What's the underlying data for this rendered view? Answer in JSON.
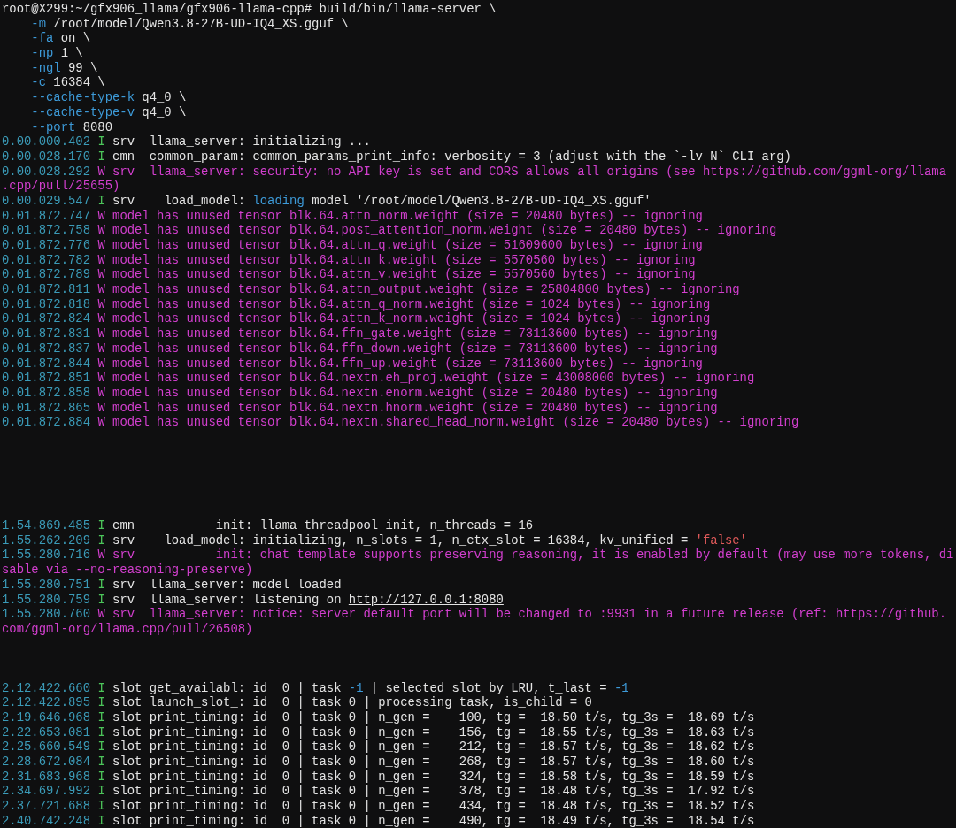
{
  "terminal": {
    "lines": [
      {
        "kind": "text",
        "segments": [
          {
            "kind": "plain",
            "text": "root@X299:~/gfx906_llama/gfx906-llama-cpp# build/bin/llama-server \\"
          }
        ]
      },
      {
        "kind": "option",
        "segments": [
          {
            "kind": "flag",
            "text": "-m"
          },
          {
            "kind": "plain",
            "text": " /root/model/Qwen3.8-27B-UD-IQ4_XS.gguf \\"
          }
        ]
      },
      {
        "kind": "option",
        "segments": [
          {
            "kind": "flag",
            "text": "-fa"
          },
          {
            "kind": "plain",
            "text": " on \\"
          }
        ]
      },
      {
        "kind": "option",
        "segments": [
          {
            "kind": "flag",
            "text": "-np"
          },
          {
            "kind": "plain",
            "text": " 1 \\"
          }
        ]
      },
      {
        "kind": "option",
        "segments": [
          {
            "kind": "flag",
            "text": "-ngl"
          },
          {
            "kind": "plain",
            "text": " 99 \\"
          }
        ]
      },
      {
        "kind": "option",
        "segments": [
          {
            "kind": "flag",
            "text": "-c"
          },
          {
            "kind": "plain",
            "text": " 16384 \\"
          }
        ]
      },
      {
        "kind": "option",
        "segments": [
          {
            "kind": "flag",
            "text": "--cache-type-k"
          },
          {
            "kind": "plain",
            "text": " q4_0 \\"
          }
        ]
      },
      {
        "kind": "option",
        "segments": [
          {
            "kind": "flag",
            "text": "--cache-type-v"
          },
          {
            "kind": "plain",
            "text": " q4_0 \\"
          }
        ]
      },
      {
        "kind": "option",
        "segments": [
          {
            "kind": "flag",
            "text": "--port"
          },
          {
            "kind": "plain",
            "text": " 8080"
          }
        ]
      },
      {
        "kind": "text",
        "segments": [
          {
            "kind": "time",
            "text": "0.00.000.402 "
          },
          {
            "kind": "info",
            "text": "I"
          },
          {
            "kind": "plain",
            "text": " srv  llama_server: initializing ..."
          }
        ]
      },
      {
        "kind": "text",
        "segments": [
          {
            "kind": "time",
            "text": "0.00.028.170 "
          },
          {
            "kind": "info",
            "text": "I"
          },
          {
            "kind": "plain",
            "text": " cmn  common_param: common_params_print_info: verbosity = 3 (adjust with the `-lv N` CLI arg)"
          }
        ]
      },
      {
        "kind": "text",
        "segments": [
          {
            "kind": "time",
            "text": "0.00.028.292 "
          },
          {
            "kind": "warn",
            "text": "W srv  llama_server: security: no API key is set and CORS allows all origins (see https://github.com/ggml-org/llama"
          }
        ]
      },
      {
        "kind": "text",
        "segments": [
          {
            "kind": "warn",
            "text": ".cpp/pull/25655)"
          }
        ]
      },
      {
        "kind": "text",
        "segments": [
          {
            "kind": "time",
            "text": "0.00.029.547 "
          },
          {
            "kind": "info",
            "text": "I"
          },
          {
            "kind": "plain",
            "text": " srv    load_model: "
          },
          {
            "kind": "keyword",
            "text": "loading"
          },
          {
            "kind": "plain",
            "text": " model '/root/model/Qwen3.8-27B-UD-IQ4_XS.gguf'"
          }
        ]
      },
      {
        "kind": "text",
        "segments": [
          {
            "kind": "time",
            "text": "0.01.872.747 "
          },
          {
            "kind": "warn",
            "text": "W model has unused tensor blk.64.attn_norm.weight (size = 20480 bytes) -- ignoring"
          }
        ]
      },
      {
        "kind": "text",
        "segments": [
          {
            "kind": "time",
            "text": "0.01.872.758 "
          },
          {
            "kind": "warn",
            "text": "W model has unused tensor blk.64.post_attention_norm.weight (size = 20480 bytes) -- ignoring"
          }
        ]
      },
      {
        "kind": "text",
        "segments": [
          {
            "kind": "time",
            "text": "0.01.872.776 "
          },
          {
            "kind": "warn",
            "text": "W model has unused tensor blk.64.attn_q.weight (size = 51609600 bytes) -- ignoring"
          }
        ]
      },
      {
        "kind": "text",
        "segments": [
          {
            "kind": "time",
            "text": "0.01.872.782 "
          },
          {
            "kind": "warn",
            "text": "W model has unused tensor blk.64.attn_k.weight (size = 5570560 bytes) -- ignoring"
          }
        ]
      },
      {
        "kind": "text",
        "segments": [
          {
            "kind": "time",
            "text": "0.01.872.789 "
          },
          {
            "kind": "warn",
            "text": "W model has unused tensor blk.64.attn_v.weight (size = 5570560 bytes) -- ignoring"
          }
        ]
      },
      {
        "kind": "text",
        "segments": [
          {
            "kind": "time",
            "text": "0.01.872.811 "
          },
          {
            "kind": "warn",
            "text": "W model has unused tensor blk.64.attn_output.weight (size = 25804800 bytes) -- ignoring"
          }
        ]
      },
      {
        "kind": "text",
        "segments": [
          {
            "kind": "time",
            "text": "0.01.872.818 "
          },
          {
            "kind": "warn",
            "text": "W model has unused tensor blk.64.attn_q_norm.weight (size = 1024 bytes) -- ignoring"
          }
        ]
      },
      {
        "kind": "text",
        "segments": [
          {
            "kind": "time",
            "text": "0.01.872.824 "
          },
          {
            "kind": "warn",
            "text": "W model has unused tensor blk.64.attn_k_norm.weight (size = 1024 bytes) -- ignoring"
          }
        ]
      },
      {
        "kind": "text",
        "segments": [
          {
            "kind": "time",
            "text": "0.01.872.831 "
          },
          {
            "kind": "warn",
            "text": "W model has unused tensor blk.64.ffn_gate.weight (size = 73113600 bytes) -- ignoring"
          }
        ]
      },
      {
        "kind": "text",
        "segments": [
          {
            "kind": "time",
            "text": "0.01.872.837 "
          },
          {
            "kind": "warn",
            "text": "W model has unused tensor blk.64.ffn_down.weight (size = 73113600 bytes) -- ignoring"
          }
        ]
      },
      {
        "kind": "text",
        "segments": [
          {
            "kind": "time",
            "text": "0.01.872.844 "
          },
          {
            "kind": "warn",
            "text": "W model has unused tensor blk.64.ffn_up.weight (size = 73113600 bytes) -- ignoring"
          }
        ]
      },
      {
        "kind": "text",
        "segments": [
          {
            "kind": "time",
            "text": "0.01.872.851 "
          },
          {
            "kind": "warn",
            "text": "W model has unused tensor blk.64.nextn.eh_proj.weight (size = 43008000 bytes) -- ignoring"
          }
        ]
      },
      {
        "kind": "text",
        "segments": [
          {
            "kind": "time",
            "text": "0.01.872.858 "
          },
          {
            "kind": "warn",
            "text": "W model has unused tensor blk.64.nextn.enorm.weight (size = 20480 bytes) -- ignoring"
          }
        ]
      },
      {
        "kind": "text",
        "segments": [
          {
            "kind": "time",
            "text": "0.01.872.865 "
          },
          {
            "kind": "warn",
            "text": "W model has unused tensor blk.64.nextn.hnorm.weight (size = 20480 bytes) -- ignoring"
          }
        ]
      },
      {
        "kind": "text",
        "segments": [
          {
            "kind": "time",
            "text": "0.01.872.884 "
          },
          {
            "kind": "warn",
            "text": "W model has unused tensor blk.64.nextn.shared_head_norm.weight (size = 20480 bytes) -- ignoring"
          }
        ]
      },
      {
        "kind": "blank"
      },
      {
        "kind": "blank"
      },
      {
        "kind": "blank"
      },
      {
        "kind": "blank"
      },
      {
        "kind": "blank"
      },
      {
        "kind": "blank"
      },
      {
        "kind": "text",
        "segments": [
          {
            "kind": "time",
            "text": "1.54.869.485 "
          },
          {
            "kind": "info",
            "text": "I"
          },
          {
            "kind": "plain",
            "text": " cmn           init: llama threadpool init, n_threads = 16"
          }
        ]
      },
      {
        "kind": "text",
        "segments": [
          {
            "kind": "time",
            "text": "1.55.262.209 "
          },
          {
            "kind": "info",
            "text": "I"
          },
          {
            "kind": "plain",
            "text": " srv    load_model: initializing, n_slots = 1, n_ctx_slot = 16384, kv_unified = "
          },
          {
            "kind": "string",
            "text": "'false'"
          }
        ]
      },
      {
        "kind": "text",
        "segments": [
          {
            "kind": "time",
            "text": "1.55.280.716 "
          },
          {
            "kind": "warn",
            "text": "W srv           init: chat template supports preserving reasoning, it is enabled by default (may use more tokens, di"
          }
        ]
      },
      {
        "kind": "text",
        "segments": [
          {
            "kind": "warn",
            "text": "sable via --no-reasoning-preserve)"
          }
        ]
      },
      {
        "kind": "text",
        "segments": [
          {
            "kind": "time",
            "text": "1.55.280.751 "
          },
          {
            "kind": "info",
            "text": "I"
          },
          {
            "kind": "plain",
            "text": " srv  llama_server: model loaded"
          }
        ]
      },
      {
        "kind": "text",
        "segments": [
          {
            "kind": "time",
            "text": "1.55.280.759 "
          },
          {
            "kind": "info",
            "text": "I"
          },
          {
            "kind": "plain",
            "text": " srv  llama_server: listening on "
          },
          {
            "kind": "link",
            "text": "http://127.0.0.1:8080"
          }
        ]
      },
      {
        "kind": "text",
        "segments": [
          {
            "kind": "time",
            "text": "1.55.280.760 "
          },
          {
            "kind": "warn",
            "text": "W srv  llama_server: notice: server default port will be changed to :9931 in a future release (ref: https://github."
          }
        ]
      },
      {
        "kind": "text",
        "segments": [
          {
            "kind": "warn",
            "text": "com/ggml-org/llama.cpp/pull/26508)"
          }
        ]
      },
      {
        "kind": "blank"
      },
      {
        "kind": "blank"
      },
      {
        "kind": "blank"
      },
      {
        "kind": "text",
        "segments": [
          {
            "kind": "time",
            "text": "2.12.422.660 "
          },
          {
            "kind": "info",
            "text": "I"
          },
          {
            "kind": "plain",
            "text": " slot get_availabl: id  0 | task "
          },
          {
            "kind": "number",
            "text": "-1"
          },
          {
            "kind": "plain",
            "text": " | selected slot by LRU, t_last = "
          },
          {
            "kind": "number",
            "text": "-1"
          }
        ]
      },
      {
        "kind": "text",
        "segments": [
          {
            "kind": "time",
            "text": "2.12.422.895 "
          },
          {
            "kind": "info",
            "text": "I"
          },
          {
            "kind": "plain",
            "text": " slot launch_slot_: id  0 | task 0 | processing task, is_child = 0"
          }
        ]
      },
      {
        "kind": "text",
        "segments": [
          {
            "kind": "time",
            "text": "2.19.646.968 "
          },
          {
            "kind": "info",
            "text": "I"
          },
          {
            "kind": "plain",
            "text": " slot print_timing: id  0 | task 0 | n_gen =    100, tg =  18.50 t/s, tg_3s =  18.69 t/s"
          }
        ]
      },
      {
        "kind": "text",
        "segments": [
          {
            "kind": "time",
            "text": "2.22.653.081 "
          },
          {
            "kind": "info",
            "text": "I"
          },
          {
            "kind": "plain",
            "text": " slot print_timing: id  0 | task 0 | n_gen =    156, tg =  18.55 t/s, tg_3s =  18.63 t/s"
          }
        ]
      },
      {
        "kind": "text",
        "segments": [
          {
            "kind": "time",
            "text": "2.25.660.549 "
          },
          {
            "kind": "info",
            "text": "I"
          },
          {
            "kind": "plain",
            "text": " slot print_timing: id  0 | task 0 | n_gen =    212, tg =  18.57 t/s, tg_3s =  18.62 t/s"
          }
        ]
      },
      {
        "kind": "text",
        "segments": [
          {
            "kind": "time",
            "text": "2.28.672.084 "
          },
          {
            "kind": "info",
            "text": "I"
          },
          {
            "kind": "plain",
            "text": " slot print_timing: id  0 | task 0 | n_gen =    268, tg =  18.57 t/s, tg_3s =  18.60 t/s"
          }
        ]
      },
      {
        "kind": "text",
        "segments": [
          {
            "kind": "time",
            "text": "2.31.683.968 "
          },
          {
            "kind": "info",
            "text": "I"
          },
          {
            "kind": "plain",
            "text": " slot print_timing: id  0 | task 0 | n_gen =    324, tg =  18.58 t/s, tg_3s =  18.59 t/s"
          }
        ]
      },
      {
        "kind": "text",
        "segments": [
          {
            "kind": "time",
            "text": "2.34.697.992 "
          },
          {
            "kind": "info",
            "text": "I"
          },
          {
            "kind": "plain",
            "text": " slot print_timing: id  0 | task 0 | n_gen =    378, tg =  18.48 t/s, tg_3s =  17.92 t/s"
          }
        ]
      },
      {
        "kind": "text",
        "segments": [
          {
            "kind": "time",
            "text": "2.37.721.688 "
          },
          {
            "kind": "info",
            "text": "I"
          },
          {
            "kind": "plain",
            "text": " slot print_timing: id  0 | task 0 | n_gen =    434, tg =  18.48 t/s, tg_3s =  18.52 t/s"
          }
        ]
      },
      {
        "kind": "text",
        "segments": [
          {
            "kind": "time",
            "text": "2.40.742.248 "
          },
          {
            "kind": "info",
            "text": "I"
          },
          {
            "kind": "plain",
            "text": " slot print_timing: id  0 | task 0 | n_gen =    490, tg =  18.49 t/s, tg_3s =  18.54 t/s"
          }
        ]
      }
    ]
  }
}
